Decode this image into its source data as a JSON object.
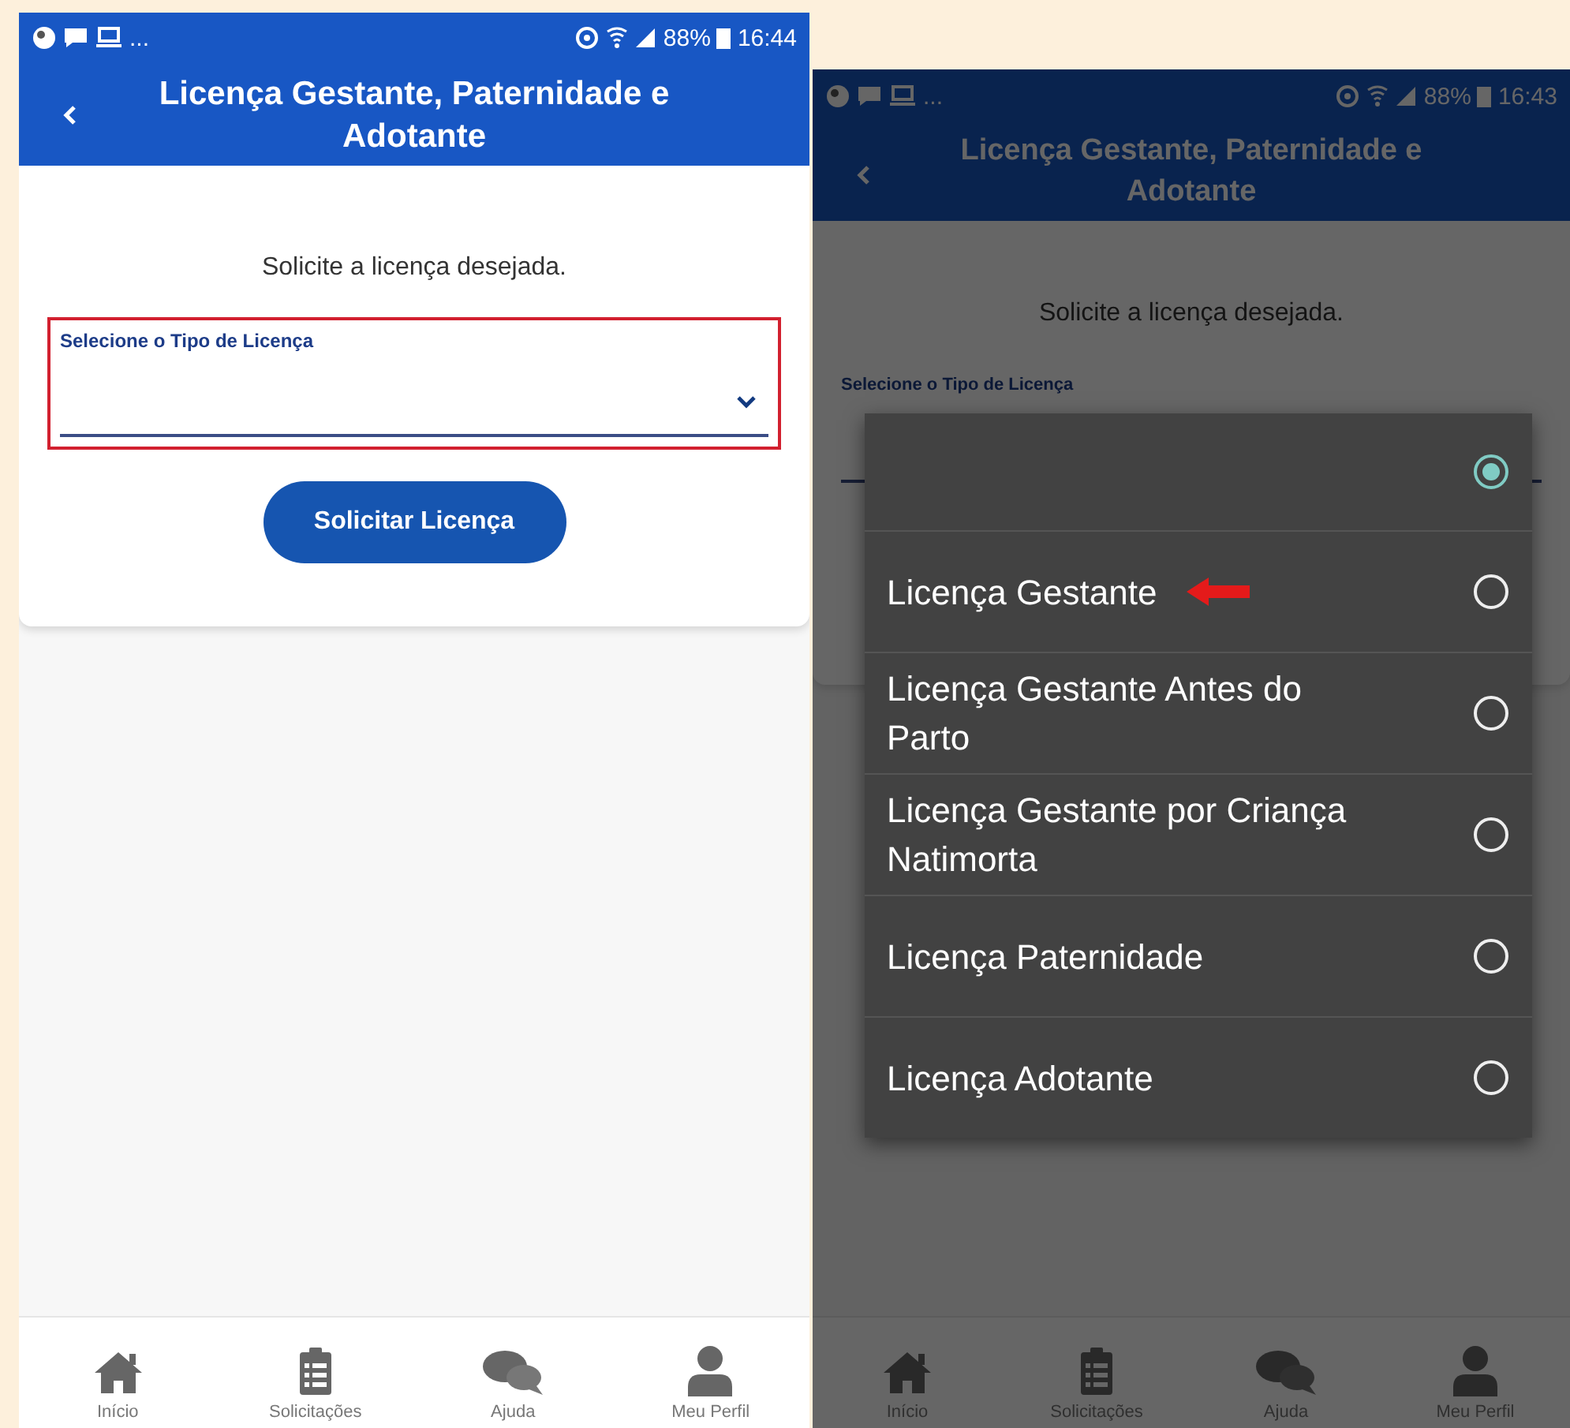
{
  "screens": [
    {
      "status_bar": {
        "notifications": "...",
        "battery": "88%",
        "time": "16:44"
      },
      "header": {
        "title": "Licença Gestante, Paternidade e Adotante"
      },
      "prompt": "Solicite a licença desejada.",
      "select": {
        "label": "Selecione o Tipo de Licença",
        "highlighted": true
      },
      "button": "Solicitar Licença",
      "dimmed": false,
      "nav": [
        {
          "kind": "home",
          "label": "Início"
        },
        {
          "kind": "list",
          "label": "Solicitações"
        },
        {
          "kind": "chat",
          "label": "Ajuda"
        },
        {
          "kind": "person",
          "label": "Meu Perfil"
        }
      ]
    },
    {
      "status_bar": {
        "notifications": "...",
        "battery": "88%",
        "time": "16:43"
      },
      "header": {
        "title": "Licença Gestante, Paternidade e Adotante"
      },
      "prompt": "Solicite a licença desejada.",
      "select": {
        "label": "Selecione o Tipo de Licença",
        "highlighted": false
      },
      "dimmed": true,
      "nav": [
        {
          "kind": "home",
          "label": "Início"
        },
        {
          "kind": "list",
          "label": "Solicitações"
        },
        {
          "kind": "chat",
          "label": "Ajuda"
        },
        {
          "kind": "person",
          "label": "Meu Perfil"
        }
      ],
      "dialog": {
        "options": [
          {
            "selected": true,
            "annotated": false
          },
          {
            "label": "Licença Gestante",
            "selected": false,
            "annotated": true
          },
          {
            "label": "Licença Gestante Antes do Parto",
            "selected": false,
            "annotated": false
          },
          {
            "label": "Licença Gestante por Criança Natimorta",
            "selected": false,
            "annotated": false
          },
          {
            "label": "Licença Paternidade",
            "selected": false,
            "annotated": false
          },
          {
            "label": "Licença Adotante",
            "selected": false,
            "annotated": false
          }
        ]
      }
    }
  ]
}
